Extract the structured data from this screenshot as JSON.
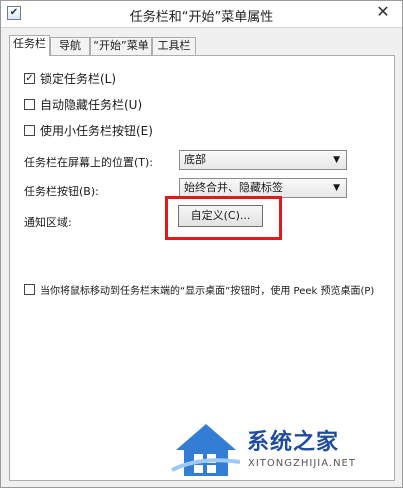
{
  "window": {
    "title": "任务栏和“开始”菜单属性",
    "close_label": "✕"
  },
  "tabs": [
    {
      "label": "任务栏",
      "active": true
    },
    {
      "label": "导航",
      "active": false
    },
    {
      "label": "“开始”菜单",
      "active": false
    },
    {
      "label": "工具栏",
      "active": false
    }
  ],
  "checkboxes": {
    "lock": {
      "label": "锁定任务栏(L)",
      "checked": "✓"
    },
    "autohide": {
      "label": "自动隐藏任务栏(U)",
      "checked": ""
    },
    "small": {
      "label": "使用小任务栏按钮(E)",
      "checked": ""
    },
    "peek": {
      "label": "当你将鼠标移动到任务栏末端的“显示桌面”按钮时，使用 Peek 预览桌面(P)",
      "checked": ""
    }
  },
  "position": {
    "label": "任务栏在屏幕上的位置(T):",
    "value": "底部"
  },
  "buttons_setting": {
    "label": "任务栏按钮(B):",
    "value": "始终合并、隐藏标签"
  },
  "notification": {
    "label": "通知区域:",
    "button": "自定义(C)..."
  },
  "watermark": {
    "text": "系统之家",
    "url": "XITONGZHIJIA.NET"
  },
  "colors": {
    "highlight": "#e01a1a",
    "brand": "#1e4c9e"
  }
}
